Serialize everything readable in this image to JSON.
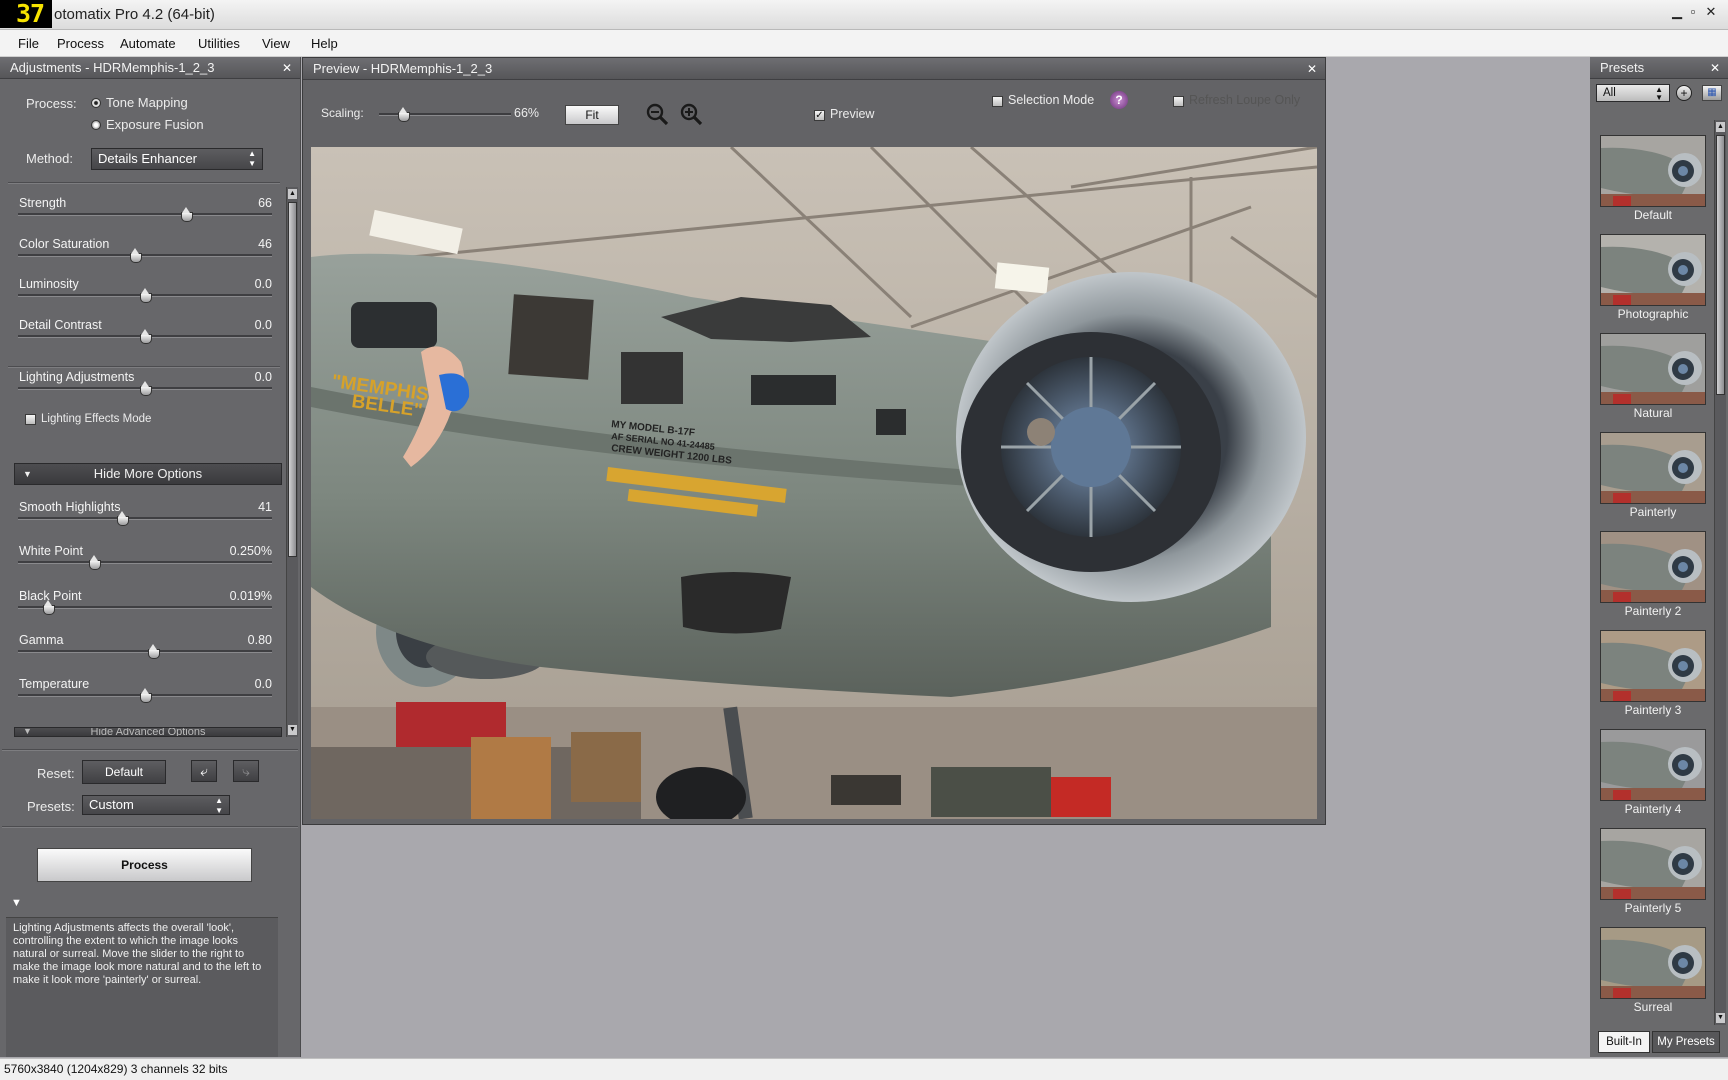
{
  "window": {
    "fps_counter": "37",
    "title": "otomatix Pro 4.2 (64-bit)"
  },
  "menu": [
    "File",
    "Process",
    "Automate",
    "Utilities",
    "View",
    "Help"
  ],
  "adjustments": {
    "title": "Adjustments - HDRMemphis-1_2_3",
    "process_label": "Process:",
    "process_options": [
      "Tone Mapping",
      "Exposure Fusion"
    ],
    "selected_process": "Tone Mapping",
    "method_label": "Method:",
    "method_value": "Details Enhancer",
    "sliders": [
      {
        "label": "Strength",
        "value": "66",
        "position": 0.66
      },
      {
        "label": "Color Saturation",
        "value": "46",
        "position": 0.46
      },
      {
        "label": "Luminosity",
        "value": "0.0",
        "position": 0.5
      },
      {
        "label": "Detail Contrast",
        "value": "0.0",
        "position": 0.5
      },
      {
        "label": "Lighting Adjustments",
        "value": "0.0",
        "position": 0.5
      }
    ],
    "lighting_effects_mode": "Lighting Effects Mode",
    "hide_more_options": "Hide More Options",
    "more_sliders": [
      {
        "label": "Smooth Highlights",
        "value": "41",
        "position": 0.41
      },
      {
        "label": "White Point",
        "value": "0.250%",
        "position": 0.3
      },
      {
        "label": "Black Point",
        "value": "0.019%",
        "position": 0.12
      },
      {
        "label": "Gamma",
        "value": "0.80",
        "position": 0.53
      },
      {
        "label": "Temperature",
        "value": "0.0",
        "position": 0.5
      }
    ],
    "hide_advanced_options": "Hide Advanced Options",
    "reset_label": "Reset:",
    "reset_button": "Default",
    "presets_label": "Presets:",
    "presets_value": "Custom",
    "process_button": "Process",
    "help_text": "Lighting Adjustments affects the overall 'look', controlling the extent to which the image looks natural or surreal.  Move the slider to the right to make the image look more natural and to the left to make it look more 'painterly' or surreal."
  },
  "preview": {
    "title": "Preview - HDRMemphis-1_2_3",
    "scaling_label": "Scaling:",
    "scaling_value": "66%",
    "fit_button": "Fit",
    "preview_checkbox": "Preview",
    "selection_mode": "Selection Mode",
    "help_symbol": "?",
    "refresh_loupe": "Refresh Loupe Only",
    "image_text": {
      "nose_art": "\"MEMPHIS\nBELLE\"",
      "stencil": "MY MODEL B-17F\nAF SERIAL NO 41-24485\nCREW WEIGHT 1200 LBS"
    }
  },
  "presets": {
    "title": "Presets",
    "filter_value": "All",
    "items": [
      "Default",
      "Photographic",
      "Natural",
      "Painterly",
      "Painterly 2",
      "Painterly 3",
      "Painterly 4",
      "Painterly 5",
      "Surreal"
    ],
    "tabs": [
      "Built-In",
      "My Presets"
    ]
  },
  "status": "5760x3840 (1204x829) 3 channels 32 bits"
}
